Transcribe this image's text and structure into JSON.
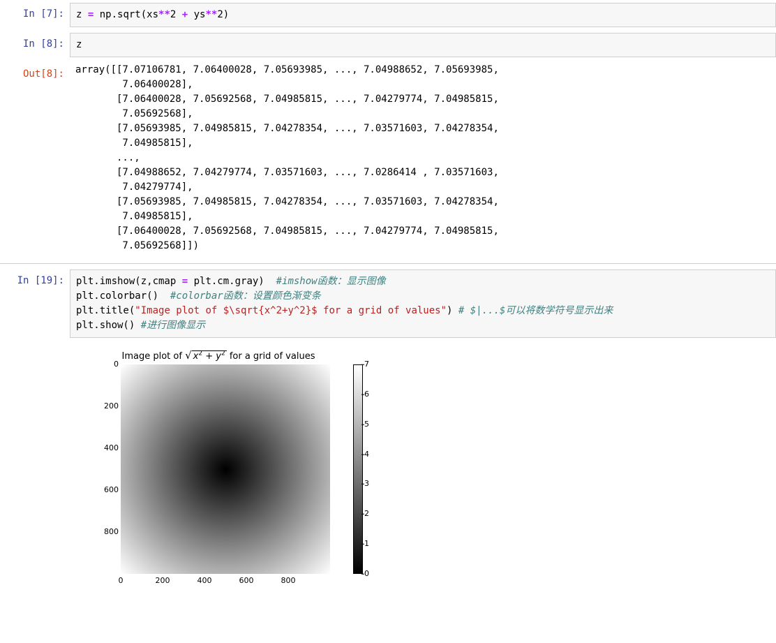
{
  "cells": {
    "c7": {
      "prompt": "In  [7]:",
      "code_parts": [
        "z ",
        "=",
        " np.sqrt(xs",
        "**",
        "2 ",
        "+",
        " ys",
        "**",
        "2)"
      ]
    },
    "c8in": {
      "prompt": "In  [8]:",
      "code": "z"
    },
    "c8out": {
      "prompt": "Out[8]:",
      "text": "array([[7.07106781, 7.06400028, 7.05693985, ..., 7.04988652, 7.05693985,\n        7.06400028],\n       [7.06400028, 7.05692568, 7.04985815, ..., 7.04279774, 7.04985815,\n        7.05692568],\n       [7.05693985, 7.04985815, 7.04278354, ..., 7.03571603, 7.04278354,\n        7.04985815],\n       ...,\n       [7.04988652, 7.04279774, 7.03571603, ..., 7.0286414 , 7.03571603,\n        7.04279774],\n       [7.05693985, 7.04985815, 7.04278354, ..., 7.03571603, 7.04278354,\n        7.04985815],\n       [7.06400028, 7.05692568, 7.04985815, ..., 7.04279774, 7.04985815,\n        7.05692568]])"
    },
    "c19": {
      "prompt": "In [19]:",
      "l1_a": "plt.imshow(z,cmap ",
      "l1_eq": "=",
      "l1_b": " plt.cm.gray)  ",
      "l1_c": "#imshow函数：显示图像",
      "l2_a": "plt.colorbar()  ",
      "l2_c": "#colorbar函数：设置颜色渐变条",
      "l3_a": "plt.title(",
      "l3_s": "\"Image plot of $\\sqrt{x^2+y^2}$ for a grid of values\"",
      "l3_b": ") ",
      "l3_c": "# $|...$可以将数学符号显示出来",
      "l4_a": "plt.show() ",
      "l4_c": "#进行图像显示"
    }
  },
  "chart_data": {
    "type": "heatmap",
    "title": "Image plot of √(x²+y²) for a grid of values",
    "xlabel": "",
    "ylabel": "",
    "xlim": [
      0,
      1000
    ],
    "ylim": [
      0,
      1000
    ],
    "x_ticks": [
      0,
      200,
      400,
      600,
      800
    ],
    "y_ticks": [
      0,
      200,
      400,
      600,
      800
    ],
    "colorbar_ticks": [
      0,
      1,
      2,
      3,
      4,
      5,
      6,
      7
    ],
    "cmap": "gray",
    "value_range": [
      0,
      7.07
    ],
    "description": "radial gradient sqrt(x^2+y^2) over 1000x1000 grid centered at (500,500)"
  }
}
